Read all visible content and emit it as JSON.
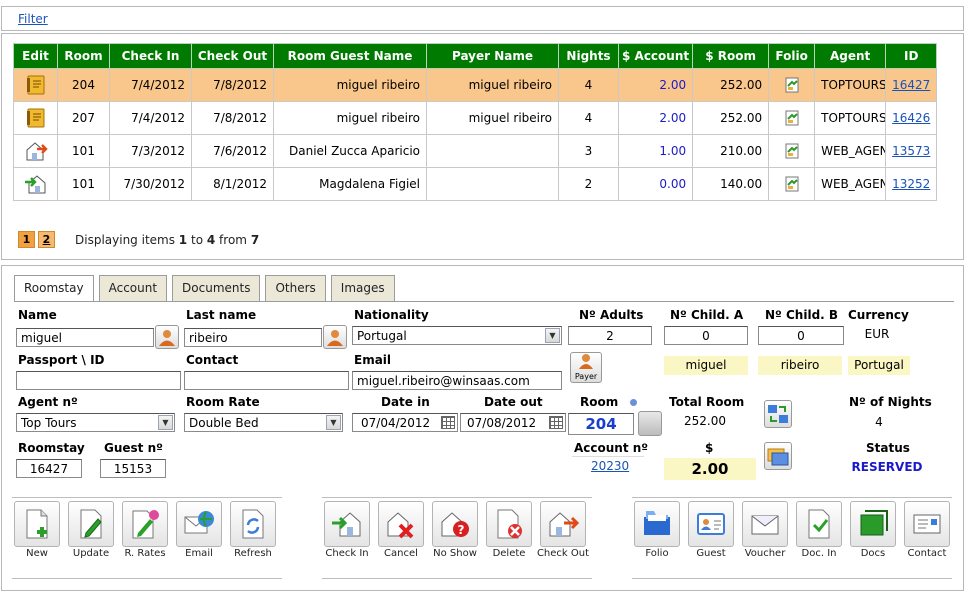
{
  "filter_link": "Filter",
  "grid": {
    "columns": [
      "Edit",
      "Room",
      "Check In",
      "Check Out",
      "Room Guest Name",
      "Payer Name",
      "Nights",
      "$ Account",
      "$ Room",
      "Folio",
      "Agent",
      "ID"
    ],
    "rows": [
      {
        "edit_icon": "notebook-icon",
        "room": "204",
        "check_in": "7/4/2012",
        "check_out": "7/8/2012",
        "guest": "miguel ribeiro",
        "payer": "miguel ribeiro",
        "nights": "4",
        "account": "2.00",
        "room_amount": "252.00",
        "agent": "TOPTOURS",
        "id": "16427",
        "selected": true
      },
      {
        "edit_icon": "notebook-icon",
        "room": "207",
        "check_in": "7/4/2012",
        "check_out": "7/8/2012",
        "guest": "miguel ribeiro",
        "payer": "miguel ribeiro",
        "nights": "4",
        "account": "2.00",
        "room_amount": "252.00",
        "agent": "TOPTOURS",
        "id": "16426",
        "selected": false
      },
      {
        "edit_icon": "checkout-icon",
        "room": "101",
        "check_in": "7/3/2012",
        "check_out": "7/6/2012",
        "guest": "Daniel Zucca Aparicio",
        "payer": "",
        "nights": "3",
        "account": "1.00",
        "room_amount": "210.00",
        "agent": "WEB_AGENT",
        "id": "13573",
        "selected": false
      },
      {
        "edit_icon": "checkin-icon",
        "room": "101",
        "check_in": "7/30/2012",
        "check_out": "8/1/2012",
        "guest": "Magdalena Figiel",
        "payer": "",
        "nights": "2",
        "account": "0.00",
        "room_amount": "140.00",
        "agent": "WEB_AGENT",
        "id": "13252",
        "selected": false
      }
    ]
  },
  "pager": {
    "pages": [
      "1",
      "2"
    ],
    "text_prefix": "Displaying items",
    "from_item": "1",
    "to_word": "to",
    "to_item": "4",
    "from_word": "from",
    "total": "7"
  },
  "tabs": [
    "Roomstay",
    "Account",
    "Documents",
    "Others",
    "Images"
  ],
  "form": {
    "name_label": "Name",
    "name": "miguel",
    "lastname_label": "Last name",
    "lastname": "ribeiro",
    "nationality_label": "Nationality",
    "nationality": "Portugal",
    "adults_label": "Nº Adults",
    "adults": "2",
    "childa_label": "Nº Child. A",
    "childa": "0",
    "childb_label": "Nº Child. B",
    "childb": "0",
    "currency_label": "Currency",
    "currency": "EUR",
    "passport_label": "Passport \\ ID",
    "passport": "",
    "contact_label": "Contact",
    "contact": "",
    "email_label": "Email",
    "email": "miguel.ribeiro@winsaas.com",
    "payer_button": "Payer",
    "payer_first": "miguel",
    "payer_last": "ribeiro",
    "payer_nationality": "Portugal",
    "agent_label": "Agent nº",
    "agent": "Top Tours",
    "rate_label": "Room Rate",
    "rate": "Double Bed",
    "date_in_label": "Date in",
    "date_in": "07/04/2012",
    "date_out_label": "Date out",
    "date_out": "07/08/2012",
    "room_label": "Room",
    "room": "204",
    "total_room_label": "Total Room",
    "total_room": "252.00",
    "nights_label": "Nº of Nights",
    "nights": "4",
    "roomstay_label": "Roomstay",
    "roomstay": "16427",
    "guest_label": "Guest nº",
    "guest": "15153",
    "account_label": "Account nº",
    "account": "20230",
    "amount_label": "$",
    "amount": "2.00",
    "status_label": "Status",
    "status": "RESERVED"
  },
  "toolbar": {
    "group1": [
      "New",
      "Update",
      "R. Rates",
      "Email",
      "Refresh"
    ],
    "group2": [
      "Check In",
      "Cancel",
      "No Show",
      "Delete",
      "Check Out"
    ],
    "group3": [
      "Folio",
      "Guest",
      "Voucher",
      "Doc. In",
      "Docs",
      "Contact"
    ]
  },
  "colors": {
    "header_green": "#007a00",
    "selected_row": "#f9c68b",
    "status_blue": "#1a1ac8"
  }
}
